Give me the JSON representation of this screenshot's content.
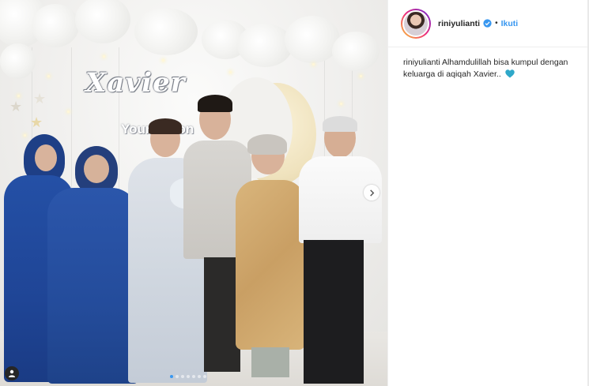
{
  "photo": {
    "neon_title": "Xavier",
    "neon_subtitle": "Young Lion",
    "carousel_dots": 7,
    "active_dot": 0
  },
  "post": {
    "username": "riniyulianti",
    "verified": true,
    "separator": "•",
    "follow_label": "Ikuti",
    "caption_user": "riniyulianti",
    "caption_text": "Alhamdulillah bisa kumpul dengan keluarga di aqiqah Xavier..",
    "caption_emoji": "blue-heart-icon"
  },
  "colors": {
    "link_blue": "#3897f0",
    "verified_blue": "#3897f0",
    "heart_blue": "#2fa8c9",
    "text": "#262626"
  }
}
